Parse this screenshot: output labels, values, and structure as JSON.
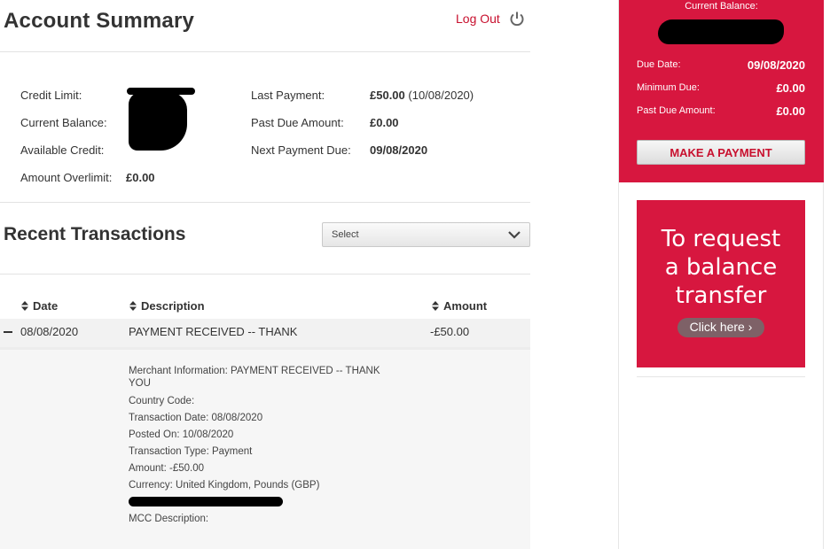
{
  "header": {
    "title": "Account Summary",
    "logout_label": "Log Out"
  },
  "summary": {
    "credit_limit_label": "Credit Limit:",
    "current_balance_label": "Current Balance:",
    "available_credit_label": "Available Credit:",
    "amount_overlimit_label": "Amount Overlimit:",
    "amount_overlimit_value": "£0.00",
    "last_payment_label": "Last Payment:",
    "last_payment_value": "£50.00",
    "last_payment_date": "(10/08/2020)",
    "past_due_label": "Past Due Amount:",
    "past_due_value": "£0.00",
    "next_payment_label": "Next Payment Due:",
    "next_payment_value": "09/08/2020"
  },
  "transactions": {
    "title": "Recent Transactions",
    "select_label": "Select",
    "columns": {
      "date": "Date",
      "description": "Description",
      "amount": "Amount"
    },
    "rows": [
      {
        "date": "08/08/2020",
        "description": "PAYMENT RECEIVED -- THANK",
        "amount": "-£50.00",
        "details": {
          "merchant": "Merchant Information: PAYMENT RECEIVED -- THANK YOU",
          "country": "Country Code:",
          "transaction_date": "Transaction Date: 08/08/2020",
          "posted_on": "Posted On: 10/08/2020",
          "transaction_type": "Transaction Type: Payment",
          "amount": "Amount:  -£50.00",
          "currency": "Currency: United Kingdom, Pounds (GBP)",
          "mcc": "MCC Description:"
        }
      }
    ]
  },
  "sidebar": {
    "current_balance_label": "Current Balance:",
    "due_date_label": "Due Date:",
    "due_date_value": "09/08/2020",
    "minimum_due_label": "Minimum Due:",
    "minimum_due_value": "£0.00",
    "past_due_label": "Past Due Amount:",
    "past_due_value": "£0.00",
    "make_payment_label": "MAKE A PAYMENT",
    "promo_line1": "To request",
    "promo_line2": "a balance",
    "promo_line3": "transfer",
    "promo_button": "Click here"
  },
  "colors": {
    "brand_red": "#d7173f",
    "link_red": "#c8102e"
  }
}
